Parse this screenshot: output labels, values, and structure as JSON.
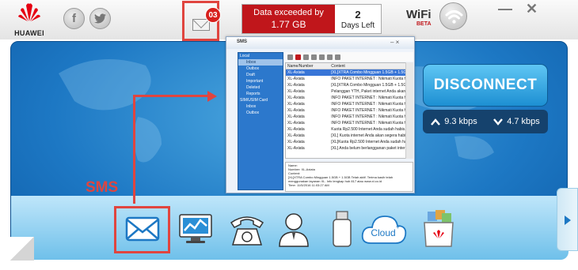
{
  "brand": {
    "name": "HUAWEI",
    "color": "#e60012"
  },
  "social": {
    "facebook": "f",
    "twitter": "t"
  },
  "messages": {
    "badge": "03"
  },
  "data_status": {
    "line1": "Data exceeded by",
    "line2": "1.77 GB",
    "days": "2",
    "days_label": "Days Left"
  },
  "wifi": {
    "label": "WiFi",
    "beta": "BETA"
  },
  "window_controls": {
    "minimize": "—",
    "close": "✕"
  },
  "connection": {
    "button": "DISCONNECT",
    "upload": "9.3 kbps",
    "download": "4.7 kbps",
    "upload_icon": "chevron-up-icon",
    "download_icon": "chevron-down-icon"
  },
  "annotation": {
    "label": "SMS",
    "color": "#e0453f"
  },
  "dock": [
    {
      "name": "sms",
      "icon": "envelope-icon"
    },
    {
      "name": "statistics",
      "icon": "monitor-chart-icon"
    },
    {
      "name": "phone",
      "icon": "telephone-icon"
    },
    {
      "name": "contacts",
      "icon": "user-icon"
    },
    {
      "name": "usb",
      "icon": "usb-drive-icon"
    },
    {
      "name": "cloud",
      "label": "Cloud",
      "icon": "cloud-plus-icon"
    },
    {
      "name": "store",
      "icon": "app-store-icon"
    }
  ],
  "sms_window": {
    "title": "SMS",
    "controls": "– ×",
    "tree": [
      {
        "label": "Local",
        "level": 0
      },
      {
        "label": "Inbox",
        "level": 1,
        "selected": true
      },
      {
        "label": "Outbox",
        "level": 1
      },
      {
        "label": "Draft",
        "level": 1
      },
      {
        "label": "Important",
        "level": 1
      },
      {
        "label": "Deleted",
        "level": 1
      },
      {
        "label": "Reports",
        "level": 1
      },
      {
        "label": "SIM/USIM Card",
        "level": 0
      },
      {
        "label": "Inbox",
        "level": 1
      },
      {
        "label": "Outbox",
        "level": 1
      }
    ],
    "columns": [
      "Name/Number",
      "Content",
      ""
    ],
    "rows": [
      [
        "XL-Axiata",
        "[XL]XTRA Combo Mingguan 1.5GB + 1.5GB Telah aktif",
        "11"
      ],
      [
        "XL-Axiata",
        "INFO PAKET INTERNET : Nikmati Kuota hingga 1.5GB...",
        "11"
      ],
      [
        "XL-Axiata",
        "[XL]XTRA Combo Mingguan 1.5GB + 1.5GB Telah aktif",
        "11"
      ],
      [
        "XL-Axiata",
        "Pelanggan YTH, Paket internet Anda akan segera habis",
        "11"
      ],
      [
        "XL-Axiata",
        "INFO PAKET INTERNET : Nikmati Kuota hingga 1.5GB...",
        "11"
      ],
      [
        "XL-Axiata",
        "INFO PAKET INTERNET : Nikmati Kuota hingga 1.5GB...",
        "11"
      ],
      [
        "XL-Axiata",
        "INFO PAKET INTERNET : Nikmati Kuota hingga 1.5GB...",
        "11"
      ],
      [
        "XL-Axiata",
        "INFO PAKET INTERNET : Nikmati Kuota hingga 1.5GB...",
        "11"
      ],
      [
        "XL-Axiata",
        "INFO PAKET INTERNET : Nikmati Kuota hingga 1.5GB...",
        "01"
      ],
      [
        "XL-Axiata",
        "Kuota Rp2.500 Internet Anda sudah habis. Beli",
        "01"
      ],
      [
        "XL-Axiata",
        "[XL] Kuota internet Anda akan segera habis",
        "01"
      ],
      [
        "XL-Axiata",
        "[XL]Kuota Rp2.500 Internet Anda sudah habis. Beli",
        "01"
      ],
      [
        "XL-Axiata",
        "[XL] Anda belum berlangganan paket internet Bergerak",
        "01"
      ]
    ],
    "selected_row": 0,
    "detail": [
      "Name:",
      "Number: XL-Axiata",
      "Content:",
      "[XL]XTRA Combo Mingguan 1.5GB + 1.5GB Telah aktif. Terima kasih telah",
      "menggunakan layanan XL. Info lengkap hub 817 atau www.xl.co.id",
      "Time: 11/5/2016 11:03:27 AM"
    ]
  }
}
